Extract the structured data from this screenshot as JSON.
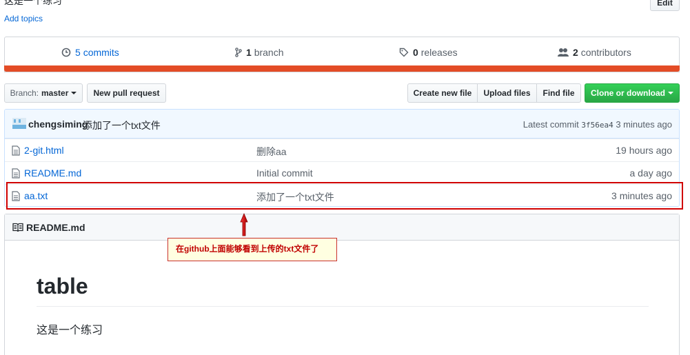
{
  "repo": {
    "description": "这是一个练习",
    "add_topics": "Add topics",
    "edit_label": "Edit"
  },
  "summary": {
    "commits_count": "5",
    "commits_label": "commits",
    "branch_count": "1",
    "branch_label": "branch",
    "releases_count": "0",
    "releases_label": "releases",
    "contributors_count": "2",
    "contributors_label": "contributors",
    "language_color": "#e34c26"
  },
  "toolbar": {
    "branch_prefix": "Branch:",
    "branch_name": "master",
    "new_pr": "New pull request",
    "create_file": "Create new file",
    "upload_files": "Upload files",
    "find_file": "Find file",
    "clone": "Clone or download"
  },
  "latest_commit": {
    "author": "chengsiming",
    "message": "添加了一个txt文件",
    "prefix": "Latest commit",
    "sha": "3f56ea4",
    "age": "3 minutes ago"
  },
  "files": [
    {
      "name": "2-git.html",
      "message": "删除aa",
      "age": "19 hours ago"
    },
    {
      "name": "README.md",
      "message": "Initial commit",
      "age": "a day ago"
    },
    {
      "name": "aa.txt",
      "message": "添加了一个txt文件",
      "age": "3 minutes ago"
    }
  ],
  "readme": {
    "header": "README.md",
    "h1": "table",
    "paragraph": "这是一个练习"
  },
  "annotation": {
    "note": "在github上面能够看到上传的txt文件了",
    "color": "#d00000"
  }
}
